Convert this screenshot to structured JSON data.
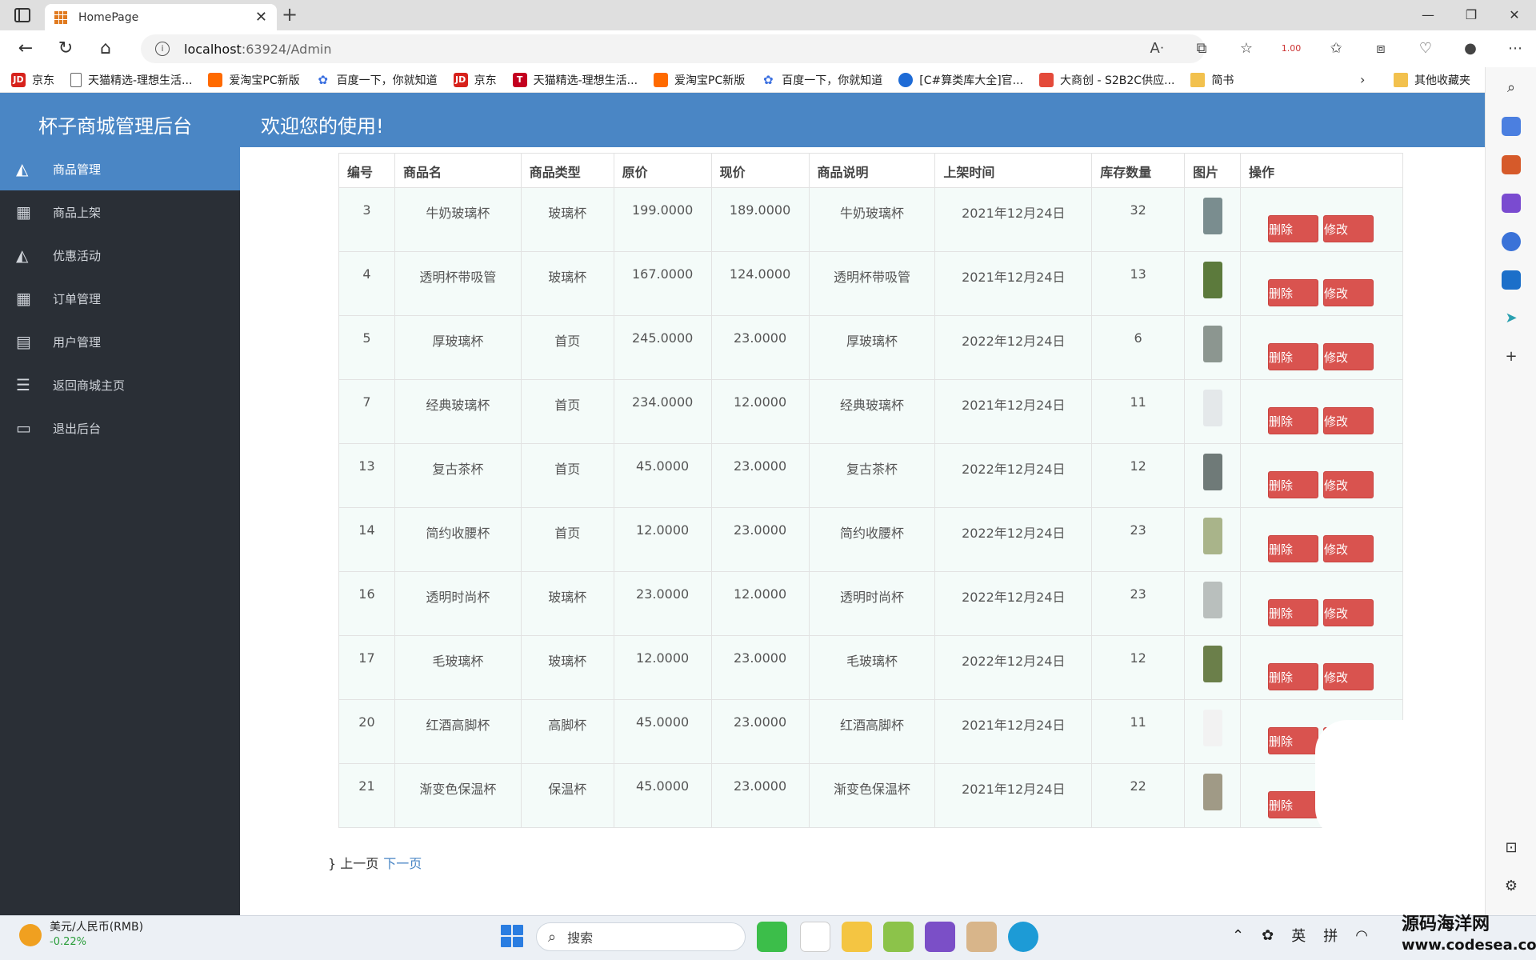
{
  "browser": {
    "tab_title": "HomePage",
    "url_host": "localhost",
    "url_rest": ":63924/Admin",
    "zoom_badge": "1.00",
    "bookmarks": [
      {
        "icon": "jd",
        "label": "京东"
      },
      {
        "icon": "doc",
        "label": "天猫精选-理想生活..."
      },
      {
        "icon": "tb",
        "label": "爱淘宝PC新版"
      },
      {
        "icon": "bd",
        "label": "百度一下，你就知道"
      },
      {
        "icon": "jd",
        "label": "京东"
      },
      {
        "icon": "tm",
        "label": "天猫精选-理想生活..."
      },
      {
        "icon": "tb",
        "label": "爱淘宝PC新版"
      },
      {
        "icon": "bd",
        "label": "百度一下，你就知道"
      },
      {
        "icon": "cs",
        "label": "[C#算类库大全]官..."
      },
      {
        "icon": "dc",
        "label": "大商创 - S2B2C供应..."
      },
      {
        "icon": "fo",
        "label": "简书"
      }
    ],
    "other_bookmarks": "其他收藏夹"
  },
  "header": {
    "brand": "杯子商城管理后台",
    "welcome": "欢迎您的使用!"
  },
  "sidebar": {
    "items": [
      {
        "label": "商品管理",
        "icon": "area-chart-icon",
        "active": true
      },
      {
        "label": "商品上架",
        "icon": "table-icon",
        "active": false
      },
      {
        "label": "优惠活动",
        "icon": "area-chart-icon",
        "active": false
      },
      {
        "label": "订单管理",
        "icon": "table-icon",
        "active": false
      },
      {
        "label": "用户管理",
        "icon": "document-icon",
        "active": false
      },
      {
        "label": "返回商城主页",
        "icon": "menu-icon",
        "active": false
      },
      {
        "label": "退出后台",
        "icon": "monitor-icon",
        "active": false
      }
    ]
  },
  "table": {
    "headers": [
      "编号",
      "商品名",
      "商品类型",
      "原价",
      "现价",
      "商品说明",
      "上架时间",
      "库存数量",
      "图片",
      "操作"
    ],
    "delete_label": "删除",
    "edit_label": "修改",
    "rows": [
      {
        "id": "3",
        "name": "牛奶玻璃杯",
        "type": "玻璃杯",
        "orig": "199.0000",
        "now": "189.0000",
        "desc": "牛奶玻璃杯",
        "date": "2021年12月24日",
        "stock": "32",
        "thumb": "#7a8d8f"
      },
      {
        "id": "4",
        "name": "透明杯带吸管",
        "type": "玻璃杯",
        "orig": "167.0000",
        "now": "124.0000",
        "desc": "透明杯带吸管",
        "date": "2021年12月24日",
        "stock": "13",
        "thumb": "#5c7a3c"
      },
      {
        "id": "5",
        "name": "厚玻璃杯",
        "type": "首页",
        "orig": "245.0000",
        "now": "23.0000",
        "desc": "厚玻璃杯",
        "date": "2022年12月24日",
        "stock": "6",
        "thumb": "#8c9690"
      },
      {
        "id": "7",
        "name": "经典玻璃杯",
        "type": "首页",
        "orig": "234.0000",
        "now": "12.0000",
        "desc": "经典玻璃杯",
        "date": "2021年12月24日",
        "stock": "11",
        "thumb": "#e4e8ea"
      },
      {
        "id": "13",
        "name": "复古茶杯",
        "type": "首页",
        "orig": "45.0000",
        "now": "23.0000",
        "desc": "复古茶杯",
        "date": "2022年12月24日",
        "stock": "12",
        "thumb": "#6f7a78"
      },
      {
        "id": "14",
        "name": "简约收腰杯",
        "type": "首页",
        "orig": "12.0000",
        "now": "23.0000",
        "desc": "简约收腰杯",
        "date": "2022年12月24日",
        "stock": "23",
        "thumb": "#a9b48a"
      },
      {
        "id": "16",
        "name": "透明时尚杯",
        "type": "玻璃杯",
        "orig": "23.0000",
        "now": "12.0000",
        "desc": "透明时尚杯",
        "date": "2022年12月24日",
        "stock": "23",
        "thumb": "#b9bfbd"
      },
      {
        "id": "17",
        "name": "毛玻璃杯",
        "type": "玻璃杯",
        "orig": "12.0000",
        "now": "23.0000",
        "desc": "毛玻璃杯",
        "date": "2022年12月24日",
        "stock": "12",
        "thumb": "#6b7f4a"
      },
      {
        "id": "20",
        "name": "红酒高脚杯",
        "type": "高脚杯",
        "orig": "45.0000",
        "now": "23.0000",
        "desc": "红酒高脚杯",
        "date": "2021年12月24日",
        "stock": "11",
        "thumb": "#f2f2f2"
      },
      {
        "id": "21",
        "name": "渐变色保温杯",
        "type": "保温杯",
        "orig": "45.0000",
        "now": "23.0000",
        "desc": "渐变色保温杯",
        "date": "2021年12月24日",
        "stock": "22",
        "thumb": "#a09a86"
      }
    ]
  },
  "pager": {
    "prefix": "} 上一页",
    "next": "下一页"
  },
  "taskbar": {
    "ticker_title": "美元/人民币(RMB)",
    "ticker_change": "-0.22%",
    "search_placeholder": "搜索",
    "tray_lang": "英",
    "tray_ime": "拼"
  },
  "watermark": {
    "line1": "源码海洋网",
    "line2": "www.codesea.com"
  }
}
